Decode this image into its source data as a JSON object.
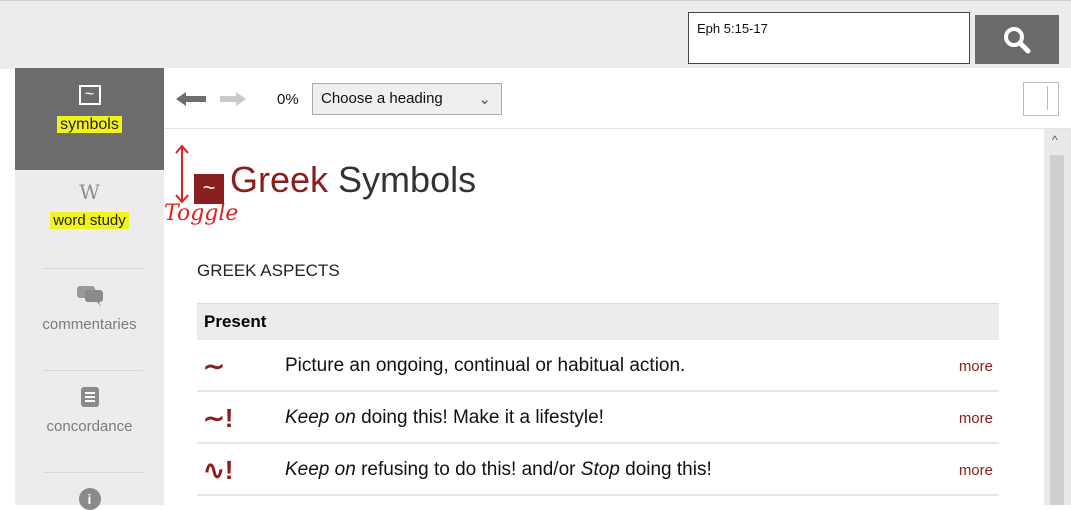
{
  "search": {
    "value": "Eph 5:15-17"
  },
  "sidebar": {
    "items": [
      {
        "label": "symbols",
        "icon": "tilde-icon"
      },
      {
        "label": "word study",
        "icon": "w-icon"
      },
      {
        "label": "commentaries",
        "icon": "speech-bubbles-icon"
      },
      {
        "label": "concordance",
        "icon": "list-icon"
      }
    ]
  },
  "toolbar": {
    "progress": "0%",
    "heading_select": "Choose a heading"
  },
  "page": {
    "title_greek": "Greek",
    "title_rest": " Symbols",
    "annotation": "Toggle",
    "section_label": "GREEK ASPECTS"
  },
  "table": {
    "header": "Present",
    "rows": [
      {
        "symbol": "∼",
        "text_em": "",
        "text": "Picture an ongoing, continual or habitual action.",
        "more": "more"
      },
      {
        "symbol": "∼!",
        "text_em": "Keep on",
        "text": " doing this! Make it a lifestyle!",
        "more": "more"
      },
      {
        "symbol": "∿!",
        "text_em": "Keep on",
        "text": " refusing to do this! and/or ",
        "text_em2": "Stop",
        "text_tail": " doing this!",
        "more": "more"
      }
    ]
  },
  "colors": {
    "accent": "#8a1d1d",
    "highlight": "#f2f21c",
    "annotation": "#e02020"
  }
}
